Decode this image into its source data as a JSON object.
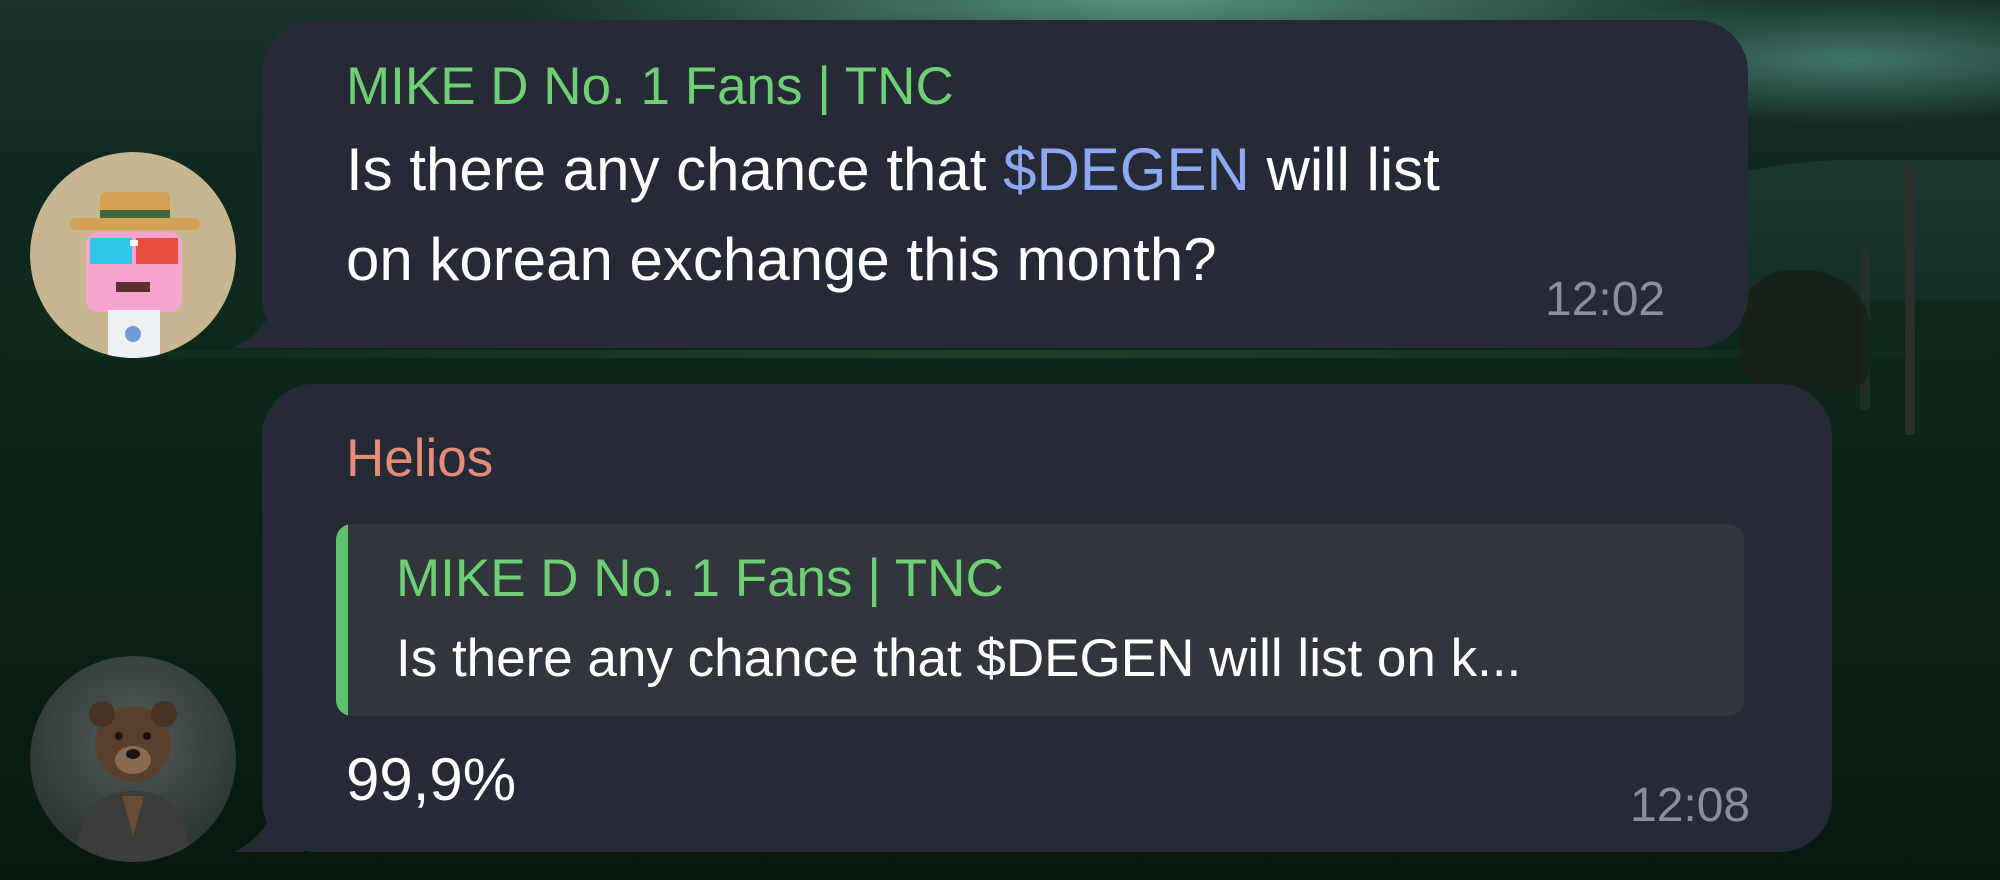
{
  "messages": [
    {
      "sender": "MIKE D No. 1 Fans | TNC",
      "sender_color": "#6fcf74",
      "text_before": "Is there any chance that ",
      "mention": "$DEGEN",
      "text_after_line1": " will list",
      "text_line2": "on korean exchange this month?",
      "time": "12:02",
      "avatar_icon": "pixel-character-avatar"
    },
    {
      "sender": "Helios",
      "sender_color": "#e58b7a",
      "reply": {
        "sender": "MIKE D No. 1 Fans | TNC",
        "text": "Is there any chance that $DEGEN will list on k..."
      },
      "text": "99,9%",
      "time": "12:08",
      "avatar_icon": "bear-avatar"
    }
  ],
  "colors": {
    "bubble": "#262a36",
    "mention": "#8ea8f2",
    "time": "#8a8f99",
    "reply_bar": "#5dc26a"
  }
}
